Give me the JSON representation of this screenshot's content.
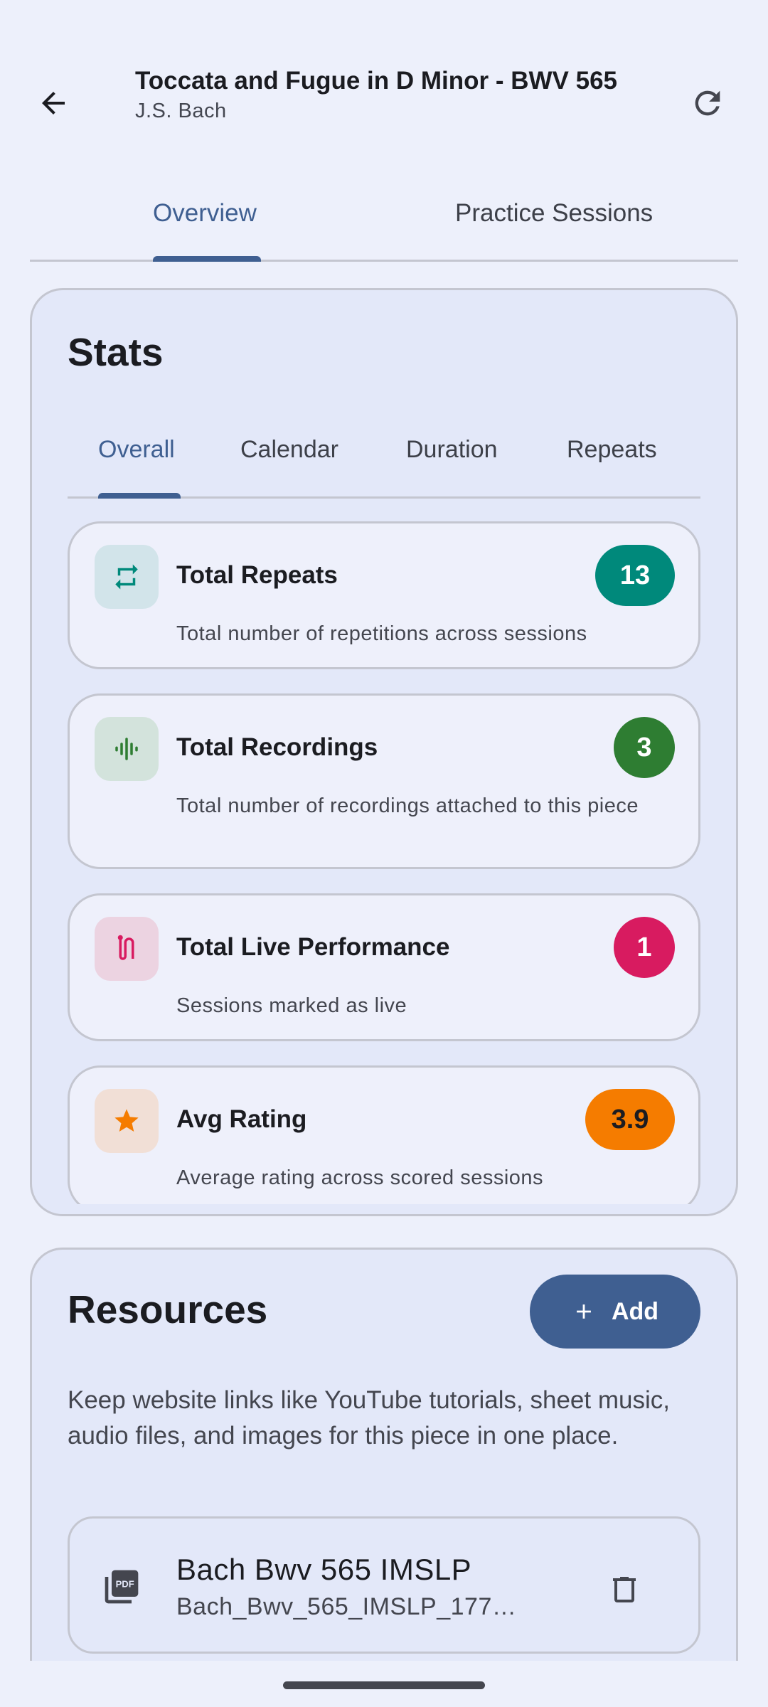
{
  "header": {
    "title": "Toccata and Fugue in D Minor - BWV 565",
    "subtitle": "J.S. Bach",
    "back_icon": "arrow-left-icon",
    "refresh_icon": "refresh-icon"
  },
  "main_tabs": [
    {
      "label": "Overview",
      "active": true
    },
    {
      "label": "Practice Sessions",
      "active": false
    }
  ],
  "stats": {
    "title": "Stats",
    "tabs": [
      {
        "label": "Overall",
        "active": true
      },
      {
        "label": "Calendar",
        "active": false
      },
      {
        "label": "Duration",
        "active": false
      },
      {
        "label": "Repeats",
        "active": false
      }
    ],
    "items": [
      {
        "label": "Total Repeats",
        "value": "13",
        "description": "Total number of repetitions across sessions",
        "icon": "repeat-icon",
        "color": "#00897b",
        "icon_bg": "#d2e4ea"
      },
      {
        "label": "Total Recordings",
        "value": "3",
        "description": "Total number of recordings attached to this piece",
        "icon": "waveform-icon",
        "color": "#2e7d32",
        "icon_bg": "#d3e3dc"
      },
      {
        "label": "Total Live Performance",
        "value": "1",
        "description": "Sessions marked as live",
        "icon": "microphone-icon",
        "color": "#d81b60",
        "icon_bg": "#ecd3e1"
      },
      {
        "label": "Avg Rating",
        "value": "3.9",
        "description": "Average rating across scored sessions",
        "icon": "star-icon",
        "color": "#f57c00",
        "icon_bg": "#f1dfd6"
      }
    ]
  },
  "resources": {
    "title": "Resources",
    "add_label": "Add",
    "description": "Keep website links like YouTube tutorials, sheet music, audio files, and images for this piece in one place.",
    "items": [
      {
        "name": "Bach Bwv 565 IMSLP",
        "file": "Bach_Bwv_565_IMSLP_177…",
        "icon": "pdf-icon"
      }
    ]
  },
  "colors": {
    "accent": "#3f5f91",
    "background": "#edf0fb",
    "card": "#e3e8f9"
  }
}
